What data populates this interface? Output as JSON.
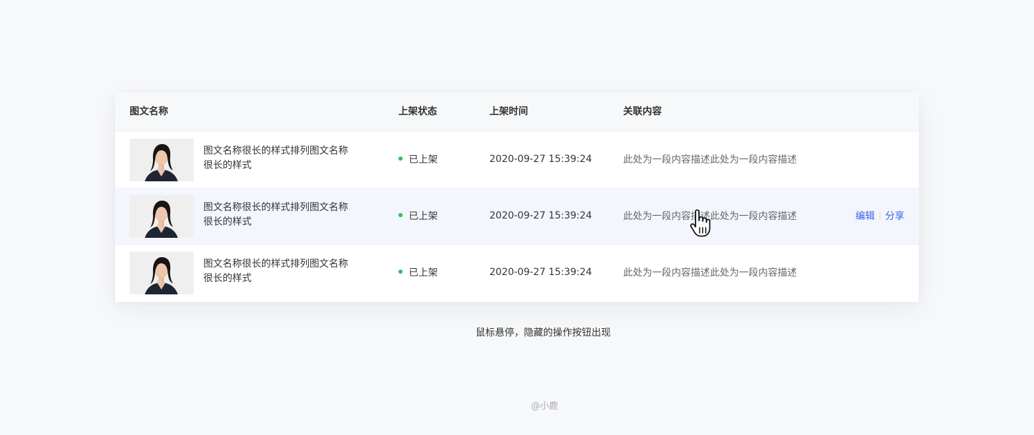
{
  "table": {
    "columns": [
      "图文名称",
      "上架状态",
      "上架时间",
      "关联内容"
    ],
    "rows": [
      {
        "title": "图文名称很长的样式排列图文名称很长的样式",
        "status": "已上架",
        "time": "2020-09-27 15:39:24",
        "description": "此处为一段内容描述此处为一段内容描述",
        "hovered": false
      },
      {
        "title": "图文名称很长的样式排列图文名称很长的样式",
        "status": "已上架",
        "time": "2020-09-27 15:39:24",
        "description": "此处为一段内容描述此处为一段内容描述",
        "hovered": true,
        "actions": [
          "编辑",
          "分享"
        ]
      },
      {
        "title": "图文名称很长的样式排列图文名称很长的样式",
        "status": "已上架",
        "time": "2020-09-27 15:39:24",
        "description": "此处为一段内容描述此处为一段内容描述",
        "hovered": false
      }
    ]
  },
  "caption": "鼠标悬停，隐藏的操作按钮出现",
  "credit": "@小鹿",
  "colors": {
    "status_dot": "#2ec05a",
    "action_link": "#3a63e6",
    "hover_row": "#f3f6fd",
    "header_bg": "#f7f8fa"
  },
  "icons": {
    "cursor": "hand-pointer-icon",
    "thumbnail": "portrait-photo"
  }
}
